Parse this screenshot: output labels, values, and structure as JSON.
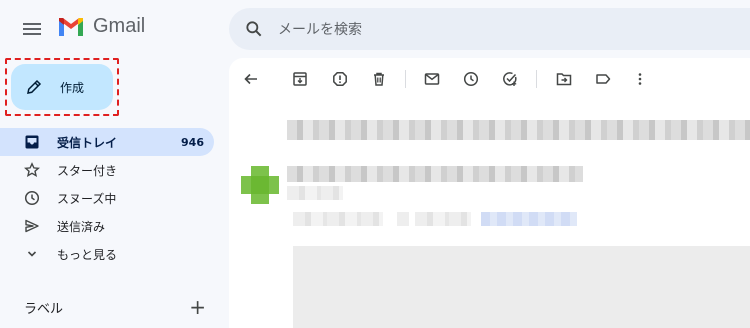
{
  "app": {
    "name": "Gmail"
  },
  "search": {
    "placeholder": "メールを検索"
  },
  "compose": {
    "label": "作成"
  },
  "nav": {
    "items": [
      {
        "label": "受信トレイ",
        "count": "946",
        "icon": "inbox-icon",
        "active": true
      },
      {
        "label": "スター付き",
        "icon": "star-icon"
      },
      {
        "label": "スヌーズ中",
        "icon": "clock-icon"
      },
      {
        "label": "送信済み",
        "icon": "send-icon"
      },
      {
        "label": "もっと見る",
        "icon": "chevron-down-icon"
      }
    ]
  },
  "labels": {
    "title": "ラベル",
    "add": "+"
  },
  "colors": {
    "accent": "#c2e7ff",
    "active_nav": "#d3e3fd",
    "highlight_border": "#e02020"
  }
}
